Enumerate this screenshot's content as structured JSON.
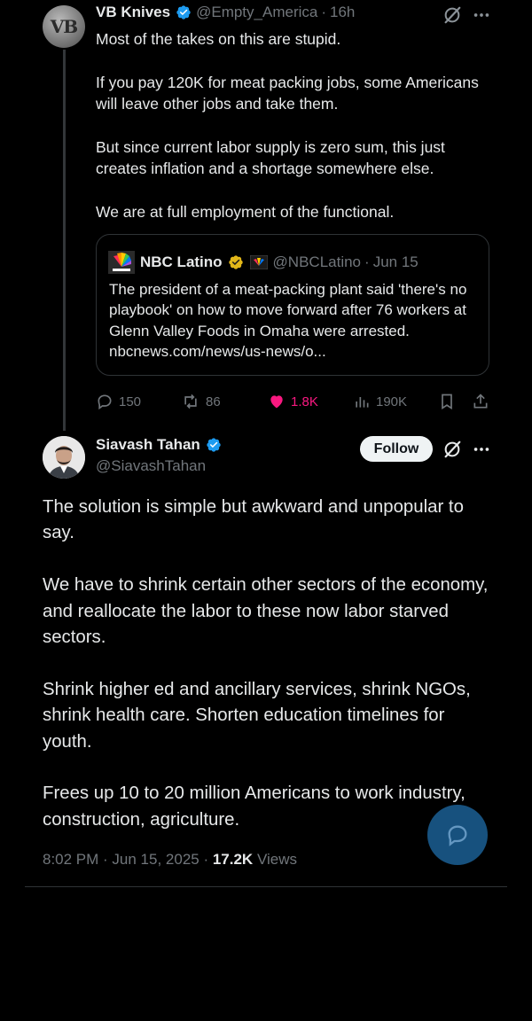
{
  "parent_tweet": {
    "avatar_text": "VB",
    "name": "VB Knives",
    "handle": "@Empty_America",
    "separator": "·",
    "time": "16h",
    "paragraphs": [
      "Most of the takes on this are stupid.",
      "If you pay 120K for meat packing jobs, some Americans will leave other jobs and take them.",
      "But since current labor supply is zero sum, this just creates inflation and a shortage somewhere else.",
      "We are at full employment of the functional."
    ],
    "quote": {
      "name": "NBC Latino",
      "handle": "@NBCLatino",
      "separator": "·",
      "date": "Jun 15",
      "text": "The president of a meat-packing plant said 'there's no playbook' on how to move forward after 76 workers at Glenn Valley Foods in Omaha were arrested. nbcnews.com/news/us-news/o..."
    },
    "actions": {
      "replies": "150",
      "reposts": "86",
      "likes": "1.8K",
      "views": "190K"
    }
  },
  "main_tweet": {
    "name": "Siavash Tahan",
    "handle": "@SiavashTahan",
    "follow_label": "Follow",
    "paragraphs": [
      "The solution is simple but awkward and unpopular to say.",
      "We have to shrink certain other sectors of the economy, and reallocate the labor to these now labor starved sectors.",
      "Shrink higher ed and ancillary services, shrink NGOs, shrink health care. Shorten education timelines for youth.",
      "Frees up 10 to 20 million Americans to work industry, construction, agriculture."
    ],
    "timestamp": "8:02 PM · Jun 15, 2025 · ",
    "views_count": "17.2K",
    "views_label": " Views"
  },
  "colors": {
    "background": "#000000",
    "text": "#e7e9ea",
    "muted": "#71767b",
    "like_pink": "#f91880",
    "verified_blue": "#1d9bf0",
    "verified_gold": "#e2b719",
    "fab_blue": "#1a5a8c"
  },
  "icons": {
    "verified": "verified-badge-icon",
    "grok": "grok-icon",
    "more": "more-icon",
    "reply": "reply-icon",
    "repost": "repost-icon",
    "like": "heart-icon",
    "views": "views-icon",
    "bookmark": "bookmark-icon",
    "share": "share-icon",
    "chat": "chat-icon"
  }
}
